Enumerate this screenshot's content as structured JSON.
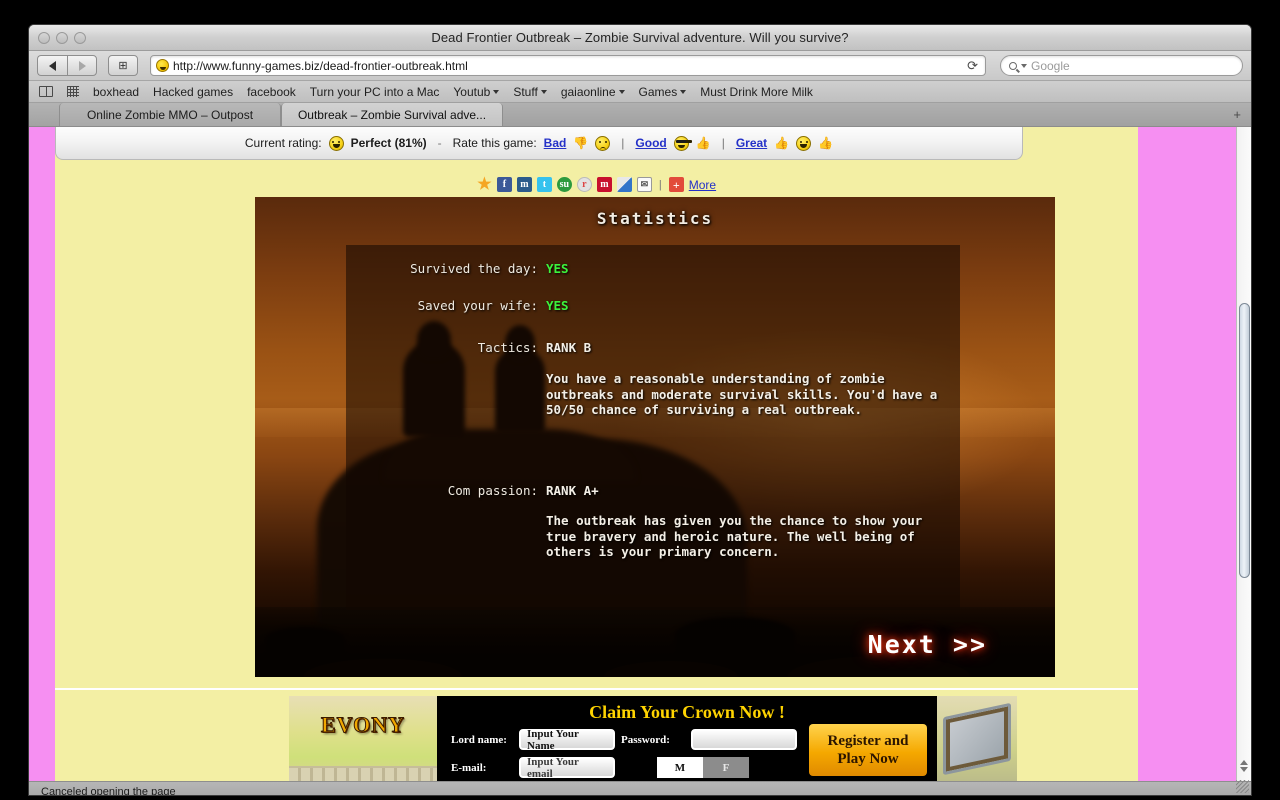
{
  "browser": {
    "window_title": "Dead Frontier Outbreak – Zombie Survival adventure. Will you survive?",
    "url": "http://www.funny-games.biz/dead-frontier-outbreak.html",
    "search_placeholder": "Google",
    "reload_glyph": "⟳",
    "back_icon": "back-arrow-icon",
    "forward_icon": "forward-arrow-icon",
    "add_bookmark_glyph": "⊞",
    "status_text": "Canceled opening the page",
    "new_tab_glyph": "+",
    "bookmarks": [
      {
        "label": "boxhead",
        "has_menu": false
      },
      {
        "label": "Hacked games",
        "has_menu": false
      },
      {
        "label": "facebook",
        "has_menu": false
      },
      {
        "label": "Turn your PC into a Mac",
        "has_menu": false
      },
      {
        "label": "Youtub",
        "has_menu": true
      },
      {
        "label": "Stuff",
        "has_menu": true
      },
      {
        "label": "gaiaonline",
        "has_menu": true
      },
      {
        "label": "Games",
        "has_menu": true
      },
      {
        "label": "Must Drink More Milk",
        "has_menu": false
      }
    ],
    "tabs": [
      {
        "label": "Online Zombie MMO – Outpost",
        "active": false
      },
      {
        "label": "Outbreak – Zombie Survival adve...",
        "active": true
      }
    ]
  },
  "page": {
    "background_color": "#f68ff2",
    "column_color": "#f3efa4",
    "rating": {
      "current_label": "Current rating:",
      "current_value": "Perfect (81%)",
      "dash": "-",
      "rate_label": "Rate this game:",
      "options": [
        {
          "label": "Bad",
          "emoji": "sad-face-icon"
        },
        {
          "label": "Good",
          "emoji": "happy-face-icon"
        },
        {
          "label": "Great",
          "emoji": "grinning-face-icon"
        }
      ],
      "separator": "|"
    },
    "social": {
      "icons": [
        {
          "name": "favorites-star-icon",
          "glyph": "★",
          "cls": "star"
        },
        {
          "name": "facebook-icon",
          "glyph": "f",
          "cls": "fb"
        },
        {
          "name": "myspace-icon",
          "glyph": "m",
          "cls": "ms"
        },
        {
          "name": "twitter-icon",
          "glyph": "t",
          "cls": "tw"
        },
        {
          "name": "stumbleupon-icon",
          "glyph": "su",
          "cls": "su"
        },
        {
          "name": "reddit-icon",
          "glyph": "r",
          "cls": "rd"
        },
        {
          "name": "mixx-icon",
          "glyph": "m",
          "cls": "mx"
        },
        {
          "name": "delicious-icon",
          "glyph": "",
          "cls": "dl"
        },
        {
          "name": "email-icon",
          "glyph": "✉",
          "cls": "mail"
        }
      ],
      "separator": "|",
      "plus_glyph": "+",
      "more_label": "More"
    },
    "game": {
      "title": "Statistics",
      "next_label": "Next >>",
      "rows": [
        {
          "label": "Survived the day:",
          "value": "YES",
          "kind": "yes",
          "desc": ""
        },
        {
          "label": "Saved your wife:",
          "value": "YES",
          "kind": "yes",
          "desc": ""
        },
        {
          "label": "Tactics:",
          "value": "RANK B",
          "kind": "rank",
          "desc": "You have a reasonable understanding of zombie\noutbreaks and moderate survival skills. You'd have a\n50/50 chance of surviving a real outbreak."
        },
        {
          "label": "Com passion:",
          "value": "RANK A+",
          "kind": "rank",
          "desc": "The outbreak has given you the chance to show your\ntrue bravery and heroic nature. The well being of\nothers is your primary concern."
        }
      ]
    },
    "ad": {
      "brand": "EVONY",
      "headline": "Claim Your Crown Now !",
      "lord_label": "Lord name:",
      "lord_value": "Input Your Name",
      "password_label": "Password:",
      "password_value": "",
      "email_label": "E-mail:",
      "email_value": "Input Your email",
      "gender_male": "M",
      "gender_female": "F",
      "cta_line1": "Register and",
      "cta_line2": "Play Now"
    }
  }
}
